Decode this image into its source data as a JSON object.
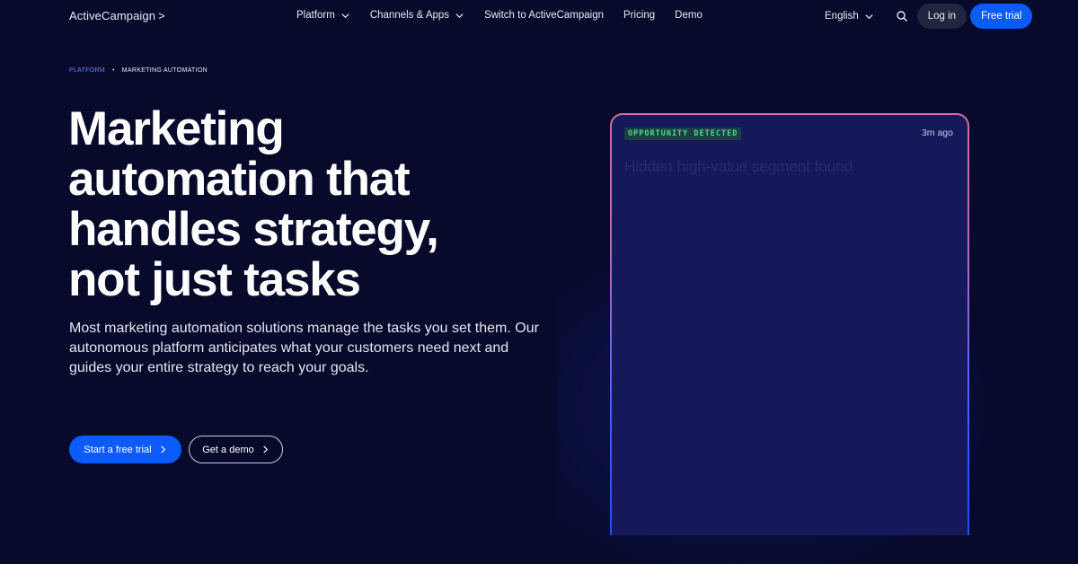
{
  "nav": {
    "logo": "ActiveCampaign",
    "logo_chevron": ">",
    "menu": [
      {
        "label": "Platform",
        "has_dropdown": true
      },
      {
        "label": "Channels & Apps",
        "has_dropdown": true
      },
      {
        "label": "Switch to ActiveCampaign",
        "has_dropdown": false
      },
      {
        "label": "Pricing",
        "has_dropdown": false
      },
      {
        "label": "Demo",
        "has_dropdown": false
      }
    ],
    "language": "English",
    "login": "Log in",
    "free_trial": "Free trial"
  },
  "breadcrumb": {
    "first": "PLATFORM",
    "separator": "•",
    "second": "MARKETING AUTOMATION"
  },
  "hero": {
    "title_lines": [
      "Marketing",
      "automation that",
      "handles strategy,",
      "not just tasks"
    ],
    "subtitle": "Most marketing automation solutions manage the tasks you set them. Our autonomous platform anticipates what your customers need next and guides your entire strategy to reach your goals.",
    "cta_primary": "Start a free trial",
    "cta_secondary": "Get a demo"
  },
  "card": {
    "badge": "OPPORTUNITY DETECTED",
    "time": "3m ago",
    "ghost_text": "Hidden high-value segment found"
  },
  "colors": {
    "background": "#070a2a",
    "accent": "#0b5cff",
    "badge_text": "#4ddc8a",
    "card_bg": "#15195a"
  },
  "icons": {
    "chevron": "chevron-down-icon",
    "search": "search-icon",
    "arrow": "chevron-right-icon"
  }
}
